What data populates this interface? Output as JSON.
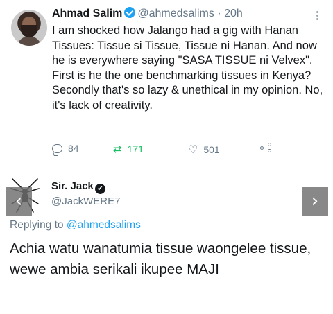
{
  "tweet": {
    "author_name": "Ahmad Salim",
    "handle": "@ahmedsalims",
    "separator": "·",
    "time": "20h",
    "text": "I am shocked how Jalango had a gig with Hanan Tissues: Tissue si Tissue, Tissue ni Hanan. And now he is everywhere saying \"SASA TISSUE ni Velvex\". First is he the one benchmarking tissues in Kenya? Secondly that's so lazy & unethical in my opinion. No, it's lack of creativity.",
    "reply_count": "84",
    "retweet_count": "171",
    "like_count": "501",
    "icons": {
      "reply": "reply-icon",
      "retweet": "retweet-icon",
      "like": "heart-icon",
      "share": "share-icon",
      "more": "more-icon",
      "verified": "verified-badge-icon"
    }
  },
  "reply": {
    "author_name": "Sir. Jack",
    "handle": "@JackWERE7",
    "replying_label": "Replying to",
    "replying_to": "@ahmedsalims",
    "text": "Achia watu wanatumia tissue waongelee tissue, wewe ambia serikali ikupee MAJI"
  },
  "nav": {
    "prev": "‹",
    "next": "›"
  },
  "colors": {
    "accent": "#1da1f2",
    "retweet": "#17bf63",
    "muted": "#657786"
  }
}
